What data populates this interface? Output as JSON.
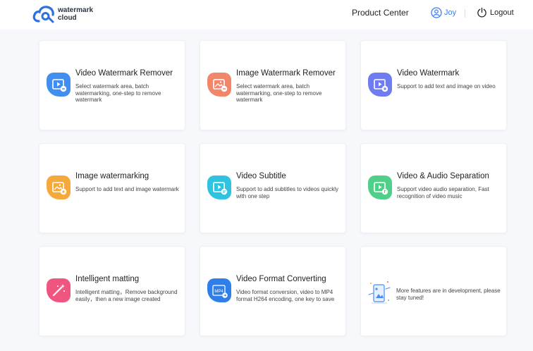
{
  "header": {
    "logo_text": "watermark\ncloud",
    "product_center": "Product Center",
    "user_name": "Joy",
    "logout_label": "Logout"
  },
  "colors": {
    "brand": "#2f6fe4",
    "link": "#3d7cf0",
    "background": "#f6f8fb"
  },
  "cards": [
    {
      "title": "Video Watermark Remover",
      "desc": "Select watermark area, batch watermarking, one-step to remove watermark",
      "icon": "video-remove-icon",
      "color": "#3f8ef0"
    },
    {
      "title": "Image Watermark Remover",
      "desc": "Select watermark area, batch watermarking, one-step to remove watermark",
      "icon": "image-remove-icon",
      "color": "#f2866a"
    },
    {
      "title": "Video Watermark",
      "desc": "Support to add text and image on video",
      "icon": "video-watermark-icon",
      "color": "#6f7cf0"
    },
    {
      "title": "Image watermarking",
      "desc": "Support to add text and image watermark",
      "icon": "image-watermark-icon",
      "color": "#f5a93a"
    },
    {
      "title": "Video Subtitle",
      "desc": "Support to add subtitles to videos quickly with one step",
      "icon": "video-subtitle-icon",
      "color": "#2fc3df"
    },
    {
      "title": "Video & Audio Separation",
      "desc": "Support video audio separation, Fast recognition of video music",
      "icon": "audio-separation-icon",
      "color": "#4fcf8a"
    },
    {
      "title": "Intelligent matting",
      "desc": "Intelligent matting，Remove background easily，then a new image created",
      "icon": "magic-wand-icon",
      "color": "#f0557f"
    },
    {
      "title": "Video Format Converting",
      "desc": "Video format conversion, video to MP4 format H264 encoding, one key to save",
      "icon": "mp4-convert-icon",
      "color": "#2f7fe8",
      "badge": "MP4"
    },
    {
      "title": "",
      "desc": "More features are in development, please stay tuned!",
      "icon": "in-development-illustration",
      "color": "#4a8cf2"
    }
  ]
}
